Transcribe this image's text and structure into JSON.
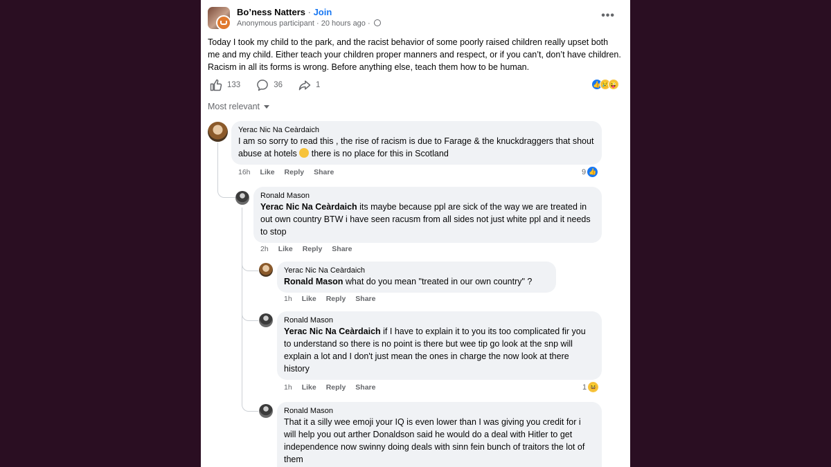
{
  "post": {
    "group_name": "Bo’ness Natters",
    "separator": "·",
    "join_label": "Join",
    "author": "Anonymous participant",
    "time": "20 hours ago",
    "visibility_icon": "globe-icon",
    "more_label": "•••",
    "text": "Today I took my child to the park, and the racist behavior of some poorly raised children really upset both me and my child. Either teach your children proper manners and respect, or if you can’t, don’t have children. Racism in all its forms is wrong. Before anything else, teach them how to be human.",
    "likes": "133",
    "comments": "36",
    "shares": "1",
    "reactions": [
      "like",
      "sad",
      "tongue"
    ]
  },
  "sort_label": "Most relevant",
  "comment_actions": {
    "like": "Like",
    "reply": "Reply",
    "share": "Share"
  },
  "comments": [
    {
      "author": "Yerac Nic Na Ceàrdaich",
      "mention": "",
      "text": "I am so sorry to read this , the rise of racism is due to Farage & the knuckdraggers that shout abuse at hotels",
      "text_after_emoji": " there is no place for this in Scotland",
      "time": "16h",
      "reaction_count": "9",
      "reaction": "like"
    },
    {
      "author": "Ronald Mason",
      "mention": "Yerac Nic Na Ceàrdaich",
      "text": " its maybe because ppl are sick of the way we are treated in out own country BTW i have seen racusm from all sides not just white ppl and it needs to stop",
      "time": "2h"
    },
    {
      "author": "Yerac Nic Na Ceàrdaich",
      "mention": "Ronald Mason",
      "text": " what do you mean \"treated in our own country\" ?",
      "time": "1h"
    },
    {
      "author": "Ronald Mason",
      "mention": "Yerac Nic Na Ceàrdaich",
      "text": " if I have to explain it to you its too complicated fir you to understand so there is no point is there but wee tip go look at the snp will explain a lot and I don't just mean the ones in charge the now look at there history",
      "time": "1h",
      "reaction_count": "1",
      "reaction": "laugh"
    },
    {
      "author": "Ronald Mason",
      "mention": "",
      "text": "That it a silly wee emoji your IQ is even lower than I was giving you credit for i will help you out arther Donaldson said he would do a deal with Hitler to get independence now swinny doing deals with sinn fein bunch of traitors the lot of them",
      "time": ""
    }
  ]
}
